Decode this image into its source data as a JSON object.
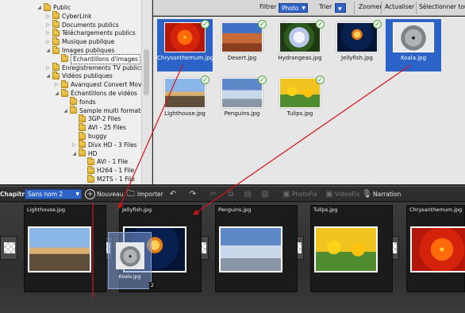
{
  "tree": {
    "items": [
      {
        "label": "Public",
        "indent": 1,
        "expander": "◢"
      },
      {
        "label": "CyberLink",
        "indent": 2,
        "expander": "▷"
      },
      {
        "label": "Documents publics",
        "indent": 2,
        "expander": "▷"
      },
      {
        "label": "Téléchargements publics",
        "indent": 2,
        "expander": "▷"
      },
      {
        "label": "Musique publique",
        "indent": 2,
        "expander": "▷"
      },
      {
        "label": "Images publiques",
        "indent": 2,
        "expander": "◢"
      },
      {
        "label": "Échantillons d'images",
        "indent": 3,
        "expander": "",
        "selected": true
      },
      {
        "label": "Enregistrements TV publics",
        "indent": 2,
        "expander": "▷"
      },
      {
        "label": "Vidéos publiques",
        "indent": 2,
        "expander": "◢"
      },
      {
        "label": "Avanquest Convert Movie",
        "indent": 3,
        "expander": "▷"
      },
      {
        "label": "Échantillons de vidéos",
        "indent": 3,
        "expander": "◢"
      },
      {
        "label": "fonds",
        "indent": 4,
        "expander": ""
      },
      {
        "label": "Sample multi formats",
        "indent": 4,
        "expander": "◢"
      },
      {
        "label": "3GP-2 Files",
        "indent": 5,
        "expander": ""
      },
      {
        "label": "AVI - 25 Files",
        "indent": 5,
        "expander": ""
      },
      {
        "label": "buggy",
        "indent": 5,
        "expander": ""
      },
      {
        "label": "Divx HD - 3 Files",
        "indent": 5,
        "expander": "▷"
      },
      {
        "label": "HD",
        "indent": 5,
        "expander": "◢"
      },
      {
        "label": "AVI - 1 File",
        "indent": 6,
        "expander": ""
      },
      {
        "label": "H264 - 1 File",
        "indent": 6,
        "expander": ""
      },
      {
        "label": "M2TS - 1 File",
        "indent": 6,
        "expander": ""
      }
    ]
  },
  "topbar": {
    "filter_label": "Filtrer",
    "filter_value": "Photo",
    "sort_label": "Trier",
    "zoom": "Zoomer",
    "refresh": "Actualiser",
    "select_all": "Sélectionner tout"
  },
  "gallery": {
    "items": [
      {
        "name": "Chrysanthemum.jpg",
        "img": "i-chrys",
        "selected": true,
        "checked": true
      },
      {
        "name": "Desert.jpg",
        "img": "i-desert",
        "selected": false,
        "checked": true
      },
      {
        "name": "Hydrangeas.jpg",
        "img": "i-hydra",
        "selected": false,
        "checked": true
      },
      {
        "name": "Jellyfish.jpg",
        "img": "i-jelly",
        "selected": false,
        "checked": true
      },
      {
        "name": "Koala.jpg",
        "img": "i-koala",
        "selected": true,
        "checked": false
      },
      {
        "name": "Lighthouse.jpg",
        "img": "i-light",
        "selected": false,
        "checked": true
      },
      {
        "name": "Penguins.jpg",
        "img": "i-peng",
        "selected": false,
        "checked": true
      },
      {
        "name": "Tulips.jpg",
        "img": "i-tulip",
        "selected": false,
        "checked": true
      }
    ]
  },
  "timeline_bar": {
    "chapters_label": "Chapitres",
    "chapter_value": "Sans nom 2",
    "new_label": "Nouveau",
    "import_label": "Importer",
    "photofix_label": "PhotoFix",
    "videofix_label": "VideoFix",
    "narration_label": "Narration"
  },
  "storyboard": {
    "clips": [
      {
        "name": "Lighthouse.jpg",
        "img": "i-light"
      },
      {
        "name": "Jellyfish.jpg",
        "img": "i-jelly"
      },
      {
        "name": "Penguins.jpg",
        "img": "i-peng"
      },
      {
        "name": "Tulips.jpg",
        "img": "i-tulip"
      },
      {
        "name": "Chrysanthemum.jpg",
        "img": "i-chrys"
      }
    ],
    "drag_ghost_label": "Koala.jpg",
    "drag_count": "2"
  },
  "colors": {
    "selection": "#2c63c9",
    "arrow": "#d2141a",
    "check": "#2f8a1c"
  }
}
